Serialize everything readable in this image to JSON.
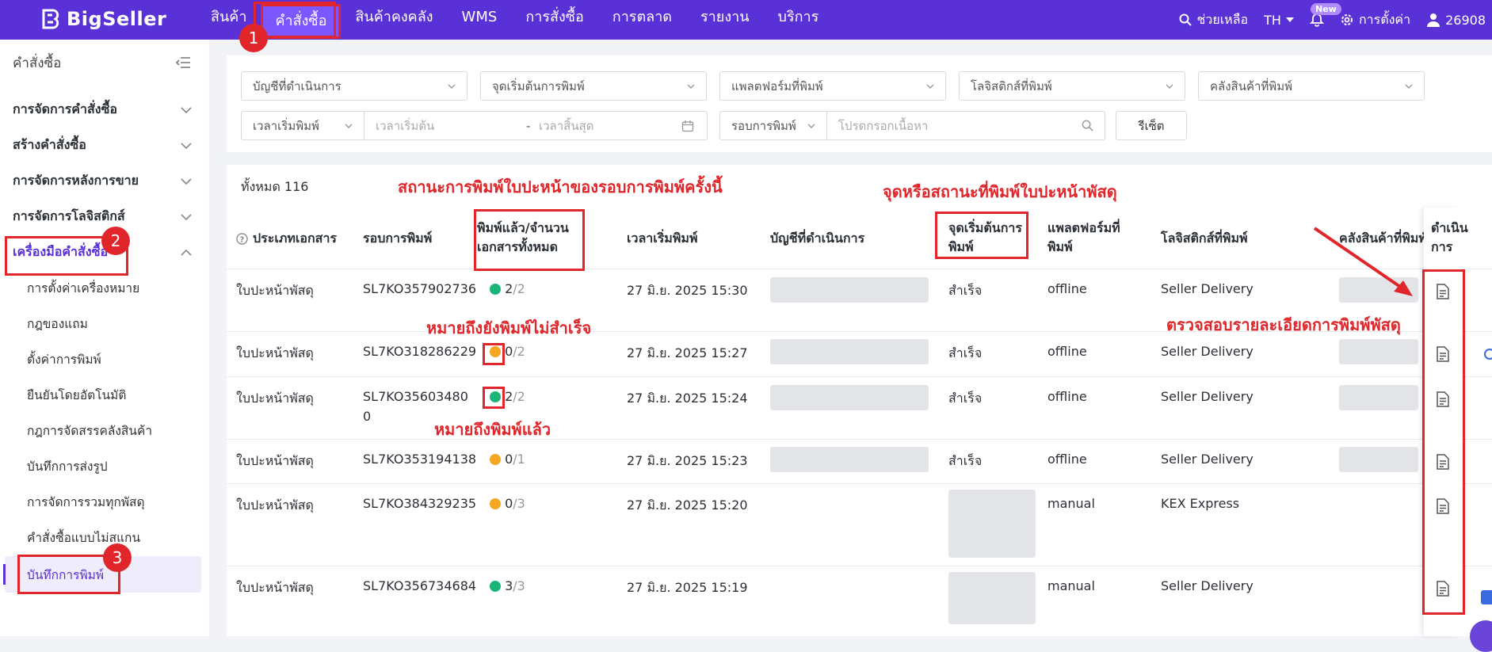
{
  "topbar": {
    "brand": "BigSeller",
    "nav": [
      "สินค้า",
      "คำสั่งซื้อ",
      "สินค้าคงคลัง",
      "WMS",
      "การสั่งซื้อ",
      "การตลาด",
      "รายงาน",
      "บริการ"
    ],
    "help": "ช่วยเหลือ",
    "lang": "TH",
    "new_badge": "New",
    "settings": "การตั้งค่า",
    "user": "26908"
  },
  "sidebar": {
    "title": "คำสั่งซื้อ",
    "groups": [
      "การจัดการคำสั่งซื้อ",
      "สร้างคำสั่งซื้อ",
      "การจัดการหลังการขาย",
      "การจัดการโลจิสติกส์",
      "เครื่องมือคำสั่งซื้อ"
    ],
    "subs": [
      "การตั้งค่าเครื่องหมาย",
      "กฎของแถม",
      "ตั้งค่าการพิมพ์",
      "ยืนยันโดยอัตโนมัติ",
      "กฎการจัดสรรคลังสินค้า",
      "บันทึกการส่งรูป",
      "การจัดการรวมทุกพัสดุ",
      "คำสั่งซื้อแบบไม่สแกน",
      "บันทึกการพิมพ์"
    ]
  },
  "filters": {
    "account": "บัญชีที่ดำเนินการ",
    "print_start": "จุดเริ่มต้นการพิมพ์",
    "platform": "แพลตฟอร์มที่พิมพ์",
    "logistics": "โลจิสติกส์ที่พิมพ์",
    "warehouse": "คลังสินค้าที่พิมพ์",
    "time_type": "เวลาเริ่มพิมพ์",
    "start_time": "เวลาเริ่มต้น",
    "dash": "-",
    "end_time": "เวลาสิ้นสุด",
    "round": "รอบการพิมพ์",
    "search_ph": "โปรดกรอกเนื้อหา",
    "reset": "รีเซ็ต"
  },
  "table": {
    "total": "ทั้งหมด 116",
    "headers": {
      "doc_type": "ประเภทเอกสาร",
      "round": "รอบการพิมพ์",
      "printed_1": "พิมพ์แล้ว/จำนวน",
      "printed_2": "เอกสารทั้งหมด",
      "start_time": "เวลาเริ่มพิมพ์",
      "account": "บัญชีที่ดำเนินการ",
      "origin_1": "จุดเริ่มต้นการ",
      "origin_2": "พิมพ์",
      "platform_1": "แพลตฟอร์มที่",
      "platform_2": "พิมพ์",
      "logistics": "โลจิสติกส์ที่พิมพ์",
      "warehouse": "คลังสินค้าที่พิมพ์",
      "op_1": "ดำเนิน",
      "op_2": "การ"
    },
    "rows": [
      {
        "doc": "ใบปะหน้าพัสดุ",
        "round": "SL7KO357902736",
        "round2": "",
        "printed": "2",
        "total": "/2",
        "time": "27 มิ.ย. 2025 15:30",
        "origin": "สำเร็จ",
        "platform": "offline",
        "logistics": "Seller Delivery"
      },
      {
        "doc": "ใบปะหน้าพัสดุ",
        "round": "SL7KO318286229",
        "round2": "",
        "printed": "0",
        "total": "/2",
        "time": "27 มิ.ย. 2025 15:27",
        "origin": "สำเร็จ",
        "platform": "offline",
        "logistics": "Seller Delivery"
      },
      {
        "doc": "ใบปะหน้าพัสดุ",
        "round": "SL7KO35603480",
        "round2": "0",
        "printed": "2",
        "total": "/2",
        "time": "27 มิ.ย. 2025 15:24",
        "origin": "สำเร็จ",
        "platform": "offline",
        "logistics": "Seller Delivery"
      },
      {
        "doc": "ใบปะหน้าพัสดุ",
        "round": "SL7KO353194138",
        "round2": "",
        "printed": "0",
        "total": "/1",
        "time": "27 มิ.ย. 2025 15:23",
        "origin": "สำเร็จ",
        "platform": "offline",
        "logistics": "Seller Delivery"
      },
      {
        "doc": "ใบปะหน้าพัสดุ",
        "round": "SL7KO384329235",
        "round2": "",
        "printed": "0",
        "total": "/3",
        "time": "27 มิ.ย. 2025 15:20",
        "origin": "",
        "platform": "manual",
        "logistics": "KEX Express"
      },
      {
        "doc": "ใบปะหน้าพัสดุ",
        "round": "SL7KO356734684",
        "round2": "",
        "printed": "3",
        "total": "/3",
        "time": "27 มิ.ย. 2025 15:19",
        "origin": "",
        "platform": "manual",
        "logistics": "Seller Delivery"
      }
    ]
  },
  "annotations": {
    "status_title": "สถานะการพิมพ์ใบปะหน้าของรอบการพิมพ์ครั้งนี้",
    "origin_title": "จุดหรือสถานะที่พิมพ์ใบปะหน้าพัสดุ",
    "not_printed": "หมายถึงยังพิมพ์ไม่สำเร็จ",
    "printed": "หมายถึงพิมพ์แล้ว",
    "check_detail": "ตรวจสอบรายละเอียดการพิมพ์พัสดุ",
    "step1": "1",
    "step2": "2",
    "step3": "3"
  },
  "colors": {
    "brand": "#5a31d6",
    "accent": "#e0262a",
    "ok": "#1bb57a",
    "warn": "#f5a623"
  }
}
